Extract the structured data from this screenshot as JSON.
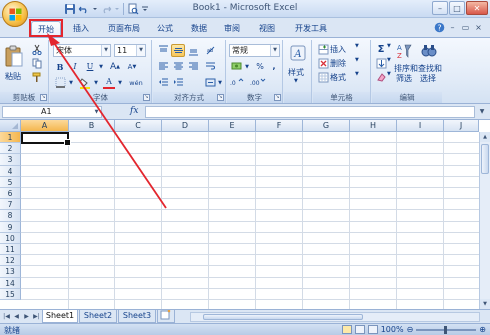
{
  "window": {
    "title": "Book1 - Microsoft Excel",
    "controls": [
      "–",
      "□",
      "✕"
    ]
  },
  "menu": {
    "tabs": [
      "开始",
      "插入",
      "页面布局",
      "公式",
      "数据",
      "审阅",
      "视图",
      "开发工具"
    ],
    "active_tab": "开始"
  },
  "ribbon": {
    "clipboard": {
      "paste_label": "粘贴",
      "group_label": "剪贴板"
    },
    "font": {
      "name": "宋体",
      "size": "11",
      "group_label": "字体",
      "bold": "B",
      "italic": "I",
      "underline": "U",
      "grow": "A",
      "shrink": "A",
      "color_letter": "A",
      "phonetic": "wén"
    },
    "alignment": {
      "group_label": "对齐方式"
    },
    "number": {
      "format": "常规",
      "percent": "%",
      "comma": ",",
      "group_label": "数字"
    },
    "styles": {
      "label": "样式",
      "letter": "A"
    },
    "cells": {
      "insert": "插入",
      "delete": "删除",
      "format": "格式",
      "group_label": "单元格"
    },
    "editing": {
      "sigma": "Σ",
      "sort_filter": "排序和",
      "sort_filter_2": "筛选",
      "find_select": "查找和",
      "find_select_2": "选择",
      "group_label": "编辑"
    }
  },
  "formula_bar": {
    "name_box": "A1",
    "fx": "fx",
    "formula": ""
  },
  "grid": {
    "columns": [
      "A",
      "B",
      "C",
      "D",
      "E",
      "F",
      "G",
      "H",
      "I",
      "J"
    ],
    "rows": [
      "1",
      "2",
      "3",
      "4",
      "5",
      "6",
      "7",
      "8",
      "9",
      "10",
      "11",
      "12",
      "13",
      "14",
      "15"
    ],
    "selected_cell": "A1"
  },
  "sheets": {
    "tabs": [
      "Sheet1",
      "Sheet2",
      "Sheet3"
    ],
    "active": "Sheet1"
  },
  "status": {
    "text": "就绪",
    "zoom": "100%"
  },
  "colors": {
    "highlight": "#e3262e",
    "ribbon_blue": "#15428b"
  }
}
